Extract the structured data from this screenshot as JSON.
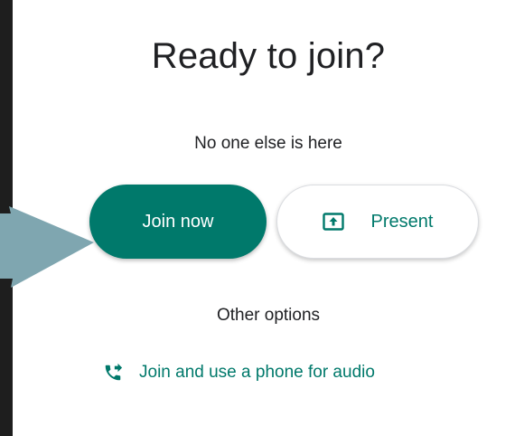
{
  "dialog": {
    "title": "Ready to join?",
    "status_text": "No one else is here",
    "join_button_label": "Join now",
    "present_button_label": "Present",
    "other_options_label": "Other options",
    "phone_audio_link": "Join and use a phone for audio"
  },
  "colors": {
    "accent": "#00796b",
    "backdrop": "#1e1e1e",
    "panel": "#ffffff",
    "text": "#202124",
    "arrow": "#7fa6b0"
  },
  "icons": {
    "present": "present-to-all-icon",
    "phone": "phone-forwarded-icon",
    "pointer": "pointer-arrow-icon"
  }
}
